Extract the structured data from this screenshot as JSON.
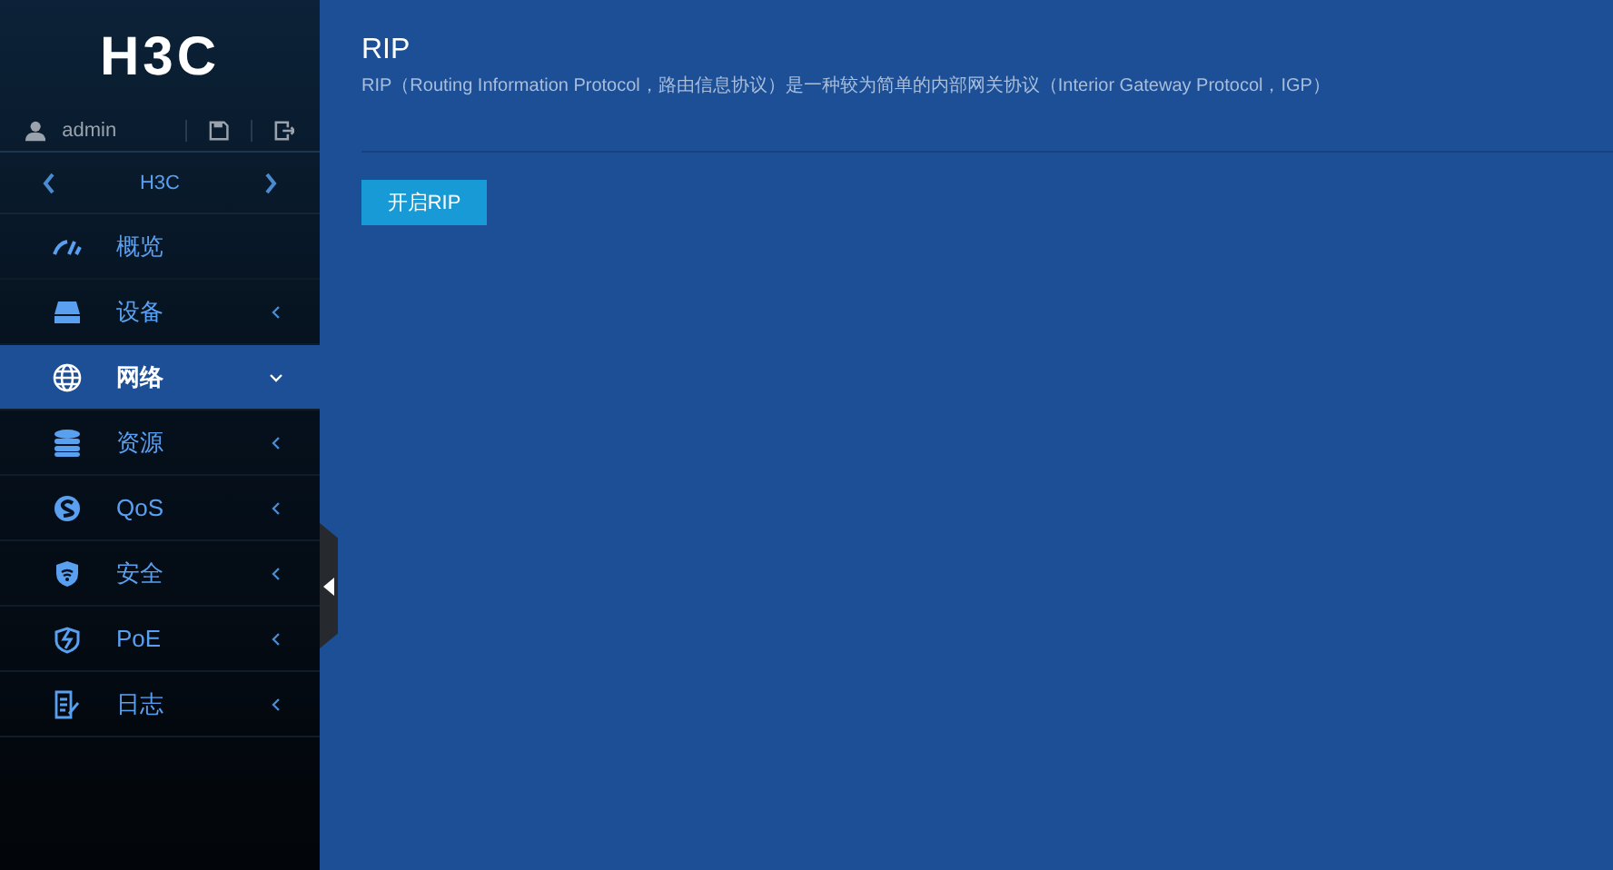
{
  "sidebar": {
    "logo": "H3C",
    "user": "admin",
    "device_nav": {
      "label": "H3C"
    },
    "items": [
      {
        "label": "概览",
        "kind": "leaf",
        "selected": false
      },
      {
        "label": "设备",
        "kind": "group",
        "selected": false,
        "expanded": false
      },
      {
        "label": "网络",
        "kind": "group",
        "selected": true,
        "expanded": true
      },
      {
        "label": "资源",
        "kind": "group",
        "selected": false,
        "expanded": false
      },
      {
        "label": "QoS",
        "kind": "group",
        "selected": false,
        "expanded": false
      },
      {
        "label": "安全",
        "kind": "group",
        "selected": false,
        "expanded": false
      },
      {
        "label": "PoE",
        "kind": "group",
        "selected": false,
        "expanded": false
      },
      {
        "label": "日志",
        "kind": "group",
        "selected": false,
        "expanded": false
      }
    ]
  },
  "page": {
    "title": "RIP",
    "description": "RIP（Routing Information Protocol，路由信息协议）是一种较为简单的内部网关协议（Interior Gateway Protocol，IGP）",
    "button": "开启RIP"
  }
}
